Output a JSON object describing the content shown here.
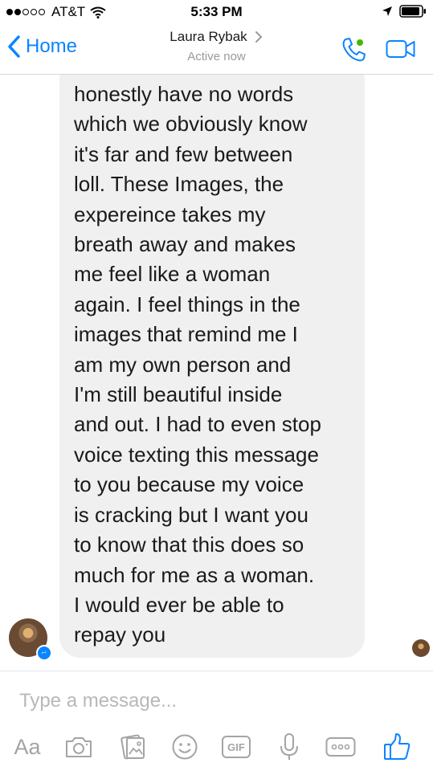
{
  "status_bar": {
    "carrier": "AT&T",
    "time": "5:33 PM"
  },
  "header": {
    "back_label": "Home",
    "contact_name": "Laura Rybak",
    "contact_status": "Active now"
  },
  "conversation": {
    "message_text": "honestly have no words\nwhich we obviously know\nit's far and few between\nloll. These  Images, the\nexpereince takes my\nbreath away and makes\nme feel like a woman\nagain. I feel things in the\nimages that  remind me I\nam my own person and\nI'm still beautiful inside\nand out. I had to even stop\nvoice texting this message\nto you because my voice\nis cracking but I want you\nto know that this does so\nmuch for me as a woman.\nI would ever be able to\nrepay you"
  },
  "composer": {
    "placeholder": "Type a message...",
    "value": "",
    "text_style_label": "Aa",
    "gif_label": "GIF"
  },
  "icons": {
    "wifi": "wifi-icon",
    "location": "location-arrow-icon",
    "battery": "battery-icon",
    "back": "chevron-left-icon",
    "contact_chevron": "chevron-right-icon",
    "call": "phone-icon",
    "video": "video-camera-icon",
    "camera": "camera-icon",
    "gallery": "photo-gallery-icon",
    "emoji": "smiley-icon",
    "microphone": "microphone-icon",
    "more": "more-icon",
    "like": "thumbs-up-icon"
  },
  "colors": {
    "accent": "#0a84ff",
    "bubble": "#f1f0f0",
    "active_dot": "#44b700",
    "icon_gray": "#a4a4a4"
  }
}
